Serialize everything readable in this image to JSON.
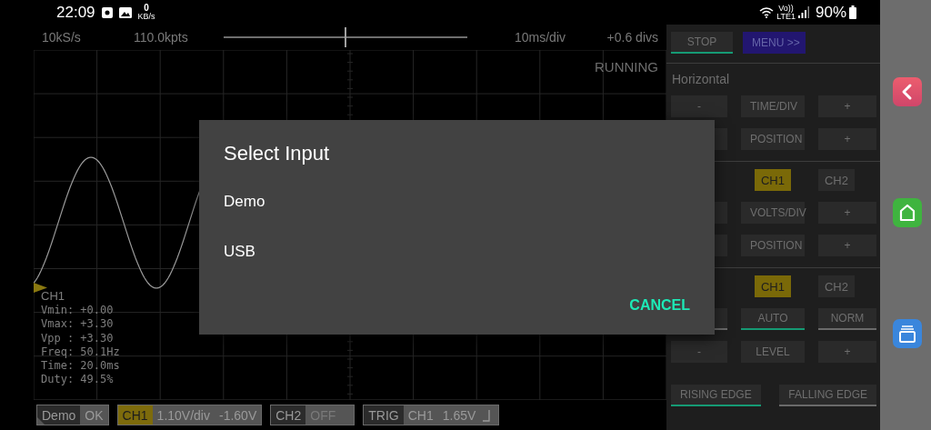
{
  "status_bar": {
    "time": "22:09",
    "net_speed": "0",
    "net_speed_unit": "KB/s",
    "volte": "Vo))",
    "network": "LTE1",
    "battery": "90%"
  },
  "scope": {
    "sample_rate": "10kS/s",
    "points": "110.0kpts",
    "position_slider": {
      "level": 0.5
    },
    "timebase": "10ms/div",
    "offset": "+0.6 divs",
    "state": "RUNNING",
    "measurements": {
      "channel": "CH1",
      "lines": [
        "Vmin: +0.00",
        "Vmax: +3.30",
        "Vpp : +3.30",
        "Freq: 50.1Hz",
        "Time: 20.0ms",
        "Duty: 49.5%"
      ]
    }
  },
  "indicators": [
    {
      "kind": "source",
      "label": "Demo",
      "values": [
        "OK"
      ]
    },
    {
      "kind": "channel",
      "label": "CH1",
      "on": true,
      "values": [
        "1.10V/div",
        "-1.60V"
      ]
    },
    {
      "kind": "channel",
      "label": "CH2",
      "on": false,
      "values": [
        "OFF"
      ]
    },
    {
      "kind": "trigger",
      "label": "TRIG",
      "values": [
        "CH1",
        "1.65V"
      ]
    }
  ],
  "panel": {
    "top_buttons": [
      {
        "kind": "choice",
        "label": "STOP",
        "selected": true
      },
      {
        "kind": "menu",
        "label": "MENU >>"
      }
    ],
    "sections": [
      {
        "heading": "Horizontal",
        "rows": [
          [
            {
              "kind": "action",
              "label": "-"
            },
            {
              "kind": "action",
              "label": "TIME/DIV"
            },
            {
              "kind": "action",
              "label": "+"
            }
          ],
          [
            {
              "kind": "covered"
            },
            {
              "kind": "action",
              "label": "POSITION"
            },
            {
              "kind": "action",
              "label": "+"
            }
          ]
        ]
      },
      {
        "rows": [
          [
            {
              "kind": "spacer"
            },
            {
              "kind": "toggle",
              "label": "CH1",
              "selected": true
            },
            {
              "kind": "toggle",
              "label": "CH2",
              "selected": false
            }
          ],
          [
            {
              "kind": "covered"
            },
            {
              "kind": "action",
              "label": "VOLTS/DIV"
            },
            {
              "kind": "action",
              "label": "+"
            }
          ],
          [
            {
              "kind": "covered"
            },
            {
              "kind": "action",
              "label": "POSITION"
            },
            {
              "kind": "action",
              "label": "+"
            }
          ]
        ]
      },
      {
        "rows": [
          [
            {
              "kind": "spacer"
            },
            {
              "kind": "toggle",
              "label": "CH1",
              "selected": true
            },
            {
              "kind": "toggle",
              "label": "CH2",
              "selected": false
            }
          ],
          [
            {
              "kind": "choice",
              "selected": false
            },
            {
              "kind": "choice",
              "label": "AUTO",
              "selected": true
            },
            {
              "kind": "choice",
              "label": "NORM",
              "selected": false
            }
          ],
          [
            {
              "kind": "action",
              "label": "-"
            },
            {
              "kind": "action",
              "label": "LEVEL"
            },
            {
              "kind": "action",
              "label": "+"
            }
          ]
        ],
        "edge_buttons": [
          {
            "kind": "choice",
            "label": "RISING EDGE",
            "selected": true
          },
          {
            "kind": "choice",
            "label": "FALLING EDGE",
            "selected": false
          }
        ]
      }
    ]
  },
  "dialog": {
    "title": "Select Input",
    "options": [
      "Demo",
      "USB"
    ],
    "buttons": [
      "CANCEL"
    ]
  }
}
